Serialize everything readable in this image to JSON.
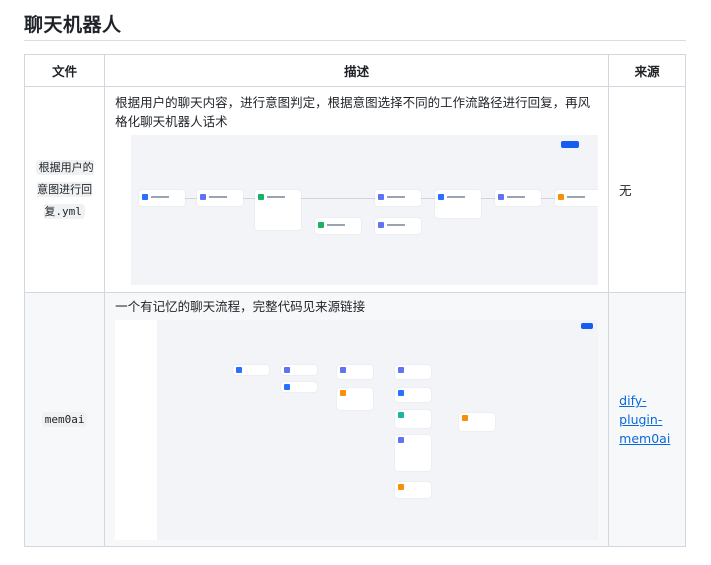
{
  "title": "聊天机器人",
  "table": {
    "headers": [
      "文件",
      "描述",
      "来源"
    ],
    "rows": [
      {
        "file": "根据用户的意图进行回复.yml",
        "description": "根据用户的聊天内容，进行意图判定，根据意图选择不同的工作流路径进行回复，再风格化聊天机器人话术",
        "source": "无",
        "source_is_link": false
      },
      {
        "file": "mem0ai",
        "description": "一个有记忆的聊天流程，完整代码见来源链接",
        "source": "dify-plugin-mem0ai",
        "source_is_link": true
      }
    ]
  },
  "colors": {
    "link": "#0969da",
    "accent": "#155eef",
    "node_start": "#2970ff",
    "node_llm": "#6172f3",
    "node_answer": "#f79009",
    "node_classifier": "#16b364"
  }
}
